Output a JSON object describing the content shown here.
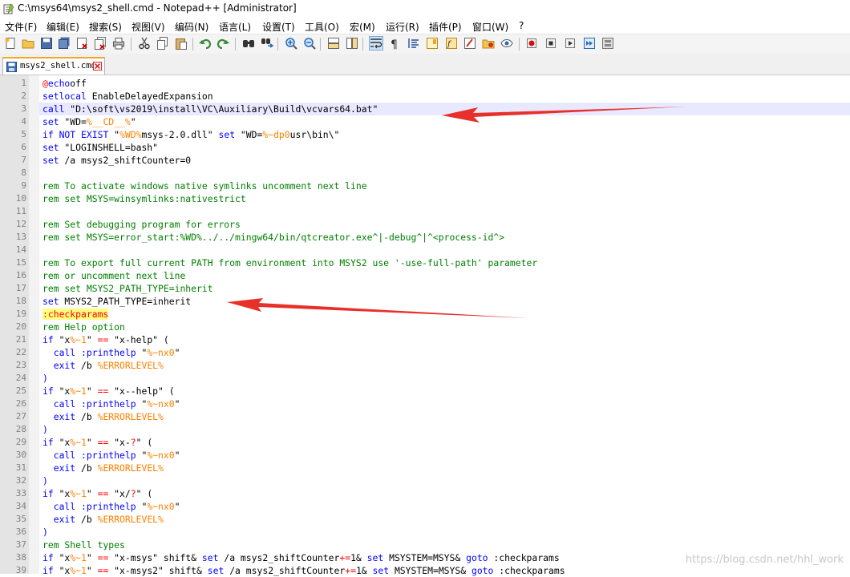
{
  "window": {
    "title": "C:\\msys64\\msys2_shell.cmd - Notepad++ [Administrator]"
  },
  "menu": [
    "文件(F)",
    "编辑(E)",
    "搜索(S)",
    "视图(V)",
    "编码(N)",
    "语言(L)",
    "设置(T)",
    "工具(O)",
    "宏(M)",
    "运行(R)",
    "插件(P)",
    "窗口(W)",
    "?"
  ],
  "toolbar_icons": [
    "new-file-icon",
    "open-file-icon",
    "save-icon",
    "save-all-icon",
    "close-icon",
    "close-all-icon",
    "print-icon",
    "cut-icon",
    "copy-icon",
    "paste-icon",
    "undo-icon",
    "redo-icon",
    "find-icon",
    "replace-icon",
    "zoom-in-icon",
    "zoom-out-icon",
    "sync-vertical-icon",
    "sync-horizontal-icon",
    "word-wrap-icon",
    "show-all-chars-icon",
    "indent-guide-icon",
    "doc-map-icon",
    "function-list-icon",
    "folder-as-workspace-icon",
    "monitor-icon",
    "record-macro-icon",
    "stop-record-icon",
    "play-macro-icon",
    "run-macro-multiple-icon",
    "save-macro-icon"
  ],
  "tab": {
    "label": "msys2_shell.cmd"
  },
  "colors": {
    "keyword": "#0000ff",
    "comment": "#008000",
    "variable": "#ff8000",
    "operator": "#ff0000",
    "label_bg": "#ffff80",
    "arrow": "#e8302a"
  },
  "code_lines": [
    [
      [
        "kw-op",
        "@"
      ],
      [
        "kw",
        "echo"
      ],
      [
        "",
        "off"
      ]
    ],
    [
      [
        "kw",
        "setlocal"
      ],
      [
        "",
        " EnableDelayedExpansion"
      ]
    ],
    [
      [
        "kw",
        "call"
      ],
      [
        "",
        " \"D:\\soft\\vs2019\\install\\VC\\Auxiliary\\Build\\vcvars64.bat\""
      ]
    ],
    [
      [
        "kw",
        "set"
      ],
      [
        "",
        " \"WD="
      ],
      [
        "var",
        "%__CD__%"
      ],
      [
        "",
        "\""
      ]
    ],
    [
      [
        "kw",
        "if"
      ],
      [
        "",
        " "
      ],
      [
        "kw",
        "NOT EXIST"
      ],
      [
        "",
        " \""
      ],
      [
        "var",
        "%WD%"
      ],
      [
        "",
        "msys-2.0.dll\" "
      ],
      [
        "kw",
        "set"
      ],
      [
        "",
        " \"WD="
      ],
      [
        "var",
        "%~dp0"
      ],
      [
        "",
        "usr\\bin\\\""
      ]
    ],
    [
      [
        "kw",
        "set"
      ],
      [
        "",
        " \"LOGINSHELL=bash\""
      ]
    ],
    [
      [
        "kw",
        "set"
      ],
      [
        "",
        " /a msys2_shiftCounter=0"
      ]
    ],
    [],
    [
      [
        "cm",
        "rem To activate windows native symlinks uncomment next line"
      ]
    ],
    [
      [
        "cm",
        "rem set MSYS=winsymlinks:nativestrict"
      ]
    ],
    [],
    [
      [
        "cm",
        "rem Set debugging program for errors"
      ]
    ],
    [
      [
        "cm",
        "rem set MSYS=error_start:%WD%../../mingw64/bin/qtcreator.exe^|-debug^|^<process-id^>"
      ]
    ],
    [],
    [
      [
        "cm",
        "rem To export full current PATH from environment into MSYS2 use '-use-full-path' parameter"
      ]
    ],
    [
      [
        "cm",
        "rem or uncomment next line"
      ]
    ],
    [
      [
        "cm",
        "rem set MSYS2_PATH_TYPE=inherit"
      ]
    ],
    [
      [
        "kw",
        "set"
      ],
      [
        "",
        " MSYS2_PATH_TYPE=inherit"
      ]
    ],
    [
      [
        "lbl",
        ":checkparams"
      ]
    ],
    [
      [
        "cm",
        "rem Help option"
      ]
    ],
    [
      [
        "kw",
        "if"
      ],
      [
        "",
        " \"x"
      ],
      [
        "var",
        "%~1"
      ],
      [
        "",
        "\" "
      ],
      [
        "kw-op",
        "=="
      ],
      [
        "",
        " \"x-help\" ("
      ]
    ],
    [
      [
        "",
        "  "
      ],
      [
        "kw",
        "call"
      ],
      [
        "",
        " "
      ],
      [
        "kw",
        ":printhelp"
      ],
      [
        "",
        " \""
      ],
      [
        "var",
        "%~nx0"
      ],
      [
        "",
        "\""
      ]
    ],
    [
      [
        "",
        "  "
      ],
      [
        "kw",
        "exit"
      ],
      [
        "",
        " /b "
      ],
      [
        "var",
        "%ERRORLEVEL%"
      ]
    ],
    [
      [
        "kw",
        ")"
      ]
    ],
    [
      [
        "kw",
        "if"
      ],
      [
        "",
        " \"x"
      ],
      [
        "var",
        "%~1"
      ],
      [
        "",
        "\" "
      ],
      [
        "kw-op",
        "=="
      ],
      [
        "",
        " \"x--help\" ("
      ]
    ],
    [
      [
        "",
        "  "
      ],
      [
        "kw",
        "call"
      ],
      [
        "",
        " "
      ],
      [
        "kw",
        ":printhelp"
      ],
      [
        "",
        " \""
      ],
      [
        "var",
        "%~nx0"
      ],
      [
        "",
        "\""
      ]
    ],
    [
      [
        "",
        "  "
      ],
      [
        "kw",
        "exit"
      ],
      [
        "",
        " /b "
      ],
      [
        "var",
        "%ERRORLEVEL%"
      ]
    ],
    [
      [
        "kw",
        ")"
      ]
    ],
    [
      [
        "kw",
        "if"
      ],
      [
        "",
        " \"x"
      ],
      [
        "var",
        "%~1"
      ],
      [
        "",
        "\" "
      ],
      [
        "kw-op",
        "=="
      ],
      [
        "",
        " \"x-"
      ],
      [
        "kw-op",
        "?"
      ],
      [
        "",
        "\" ("
      ]
    ],
    [
      [
        "",
        "  "
      ],
      [
        "kw",
        "call"
      ],
      [
        "",
        " "
      ],
      [
        "kw",
        ":printhelp"
      ],
      [
        "",
        " \""
      ],
      [
        "var",
        "%~nx0"
      ],
      [
        "",
        "\""
      ]
    ],
    [
      [
        "",
        "  "
      ],
      [
        "kw",
        "exit"
      ],
      [
        "",
        " /b "
      ],
      [
        "var",
        "%ERRORLEVEL%"
      ]
    ],
    [
      [
        "kw",
        ")"
      ]
    ],
    [
      [
        "kw",
        "if"
      ],
      [
        "",
        " \"x"
      ],
      [
        "var",
        "%~1"
      ],
      [
        "",
        "\" "
      ],
      [
        "kw-op",
        "=="
      ],
      [
        "",
        " \"x/"
      ],
      [
        "kw-op",
        "?"
      ],
      [
        "",
        "\" ("
      ]
    ],
    [
      [
        "",
        "  "
      ],
      [
        "kw",
        "call"
      ],
      [
        "",
        " "
      ],
      [
        "kw",
        ":printhelp"
      ],
      [
        "",
        " \""
      ],
      [
        "var",
        "%~nx0"
      ],
      [
        "",
        "\""
      ]
    ],
    [
      [
        "",
        "  "
      ],
      [
        "kw",
        "exit"
      ],
      [
        "",
        " /b "
      ],
      [
        "var",
        "%ERRORLEVEL%"
      ]
    ],
    [
      [
        "kw",
        ")"
      ]
    ],
    [
      [
        "cm",
        "rem Shell types"
      ]
    ],
    [
      [
        "kw",
        "if"
      ],
      [
        "",
        " \"x"
      ],
      [
        "var",
        "%~1"
      ],
      [
        "",
        "\" "
      ],
      [
        "kw-op",
        "=="
      ],
      [
        "",
        " \"x-msys\" shift& "
      ],
      [
        "kw",
        "set"
      ],
      [
        "",
        " /a msys2_shiftCounter"
      ],
      [
        "kw-op",
        "+="
      ],
      [
        "",
        "1& "
      ],
      [
        "kw",
        "set"
      ],
      [
        "",
        " MSYSTEM=MSYS& "
      ],
      [
        "kw",
        "goto"
      ],
      [
        "",
        " :checkparams"
      ]
    ],
    [
      [
        "kw",
        "if"
      ],
      [
        "",
        " \"x"
      ],
      [
        "var",
        "%~1"
      ],
      [
        "",
        "\" "
      ],
      [
        "kw-op",
        "=="
      ],
      [
        "",
        " \"x-msys2\" shift& "
      ],
      [
        "kw",
        "set"
      ],
      [
        "",
        " /a msys2_shiftCounter"
      ],
      [
        "kw-op",
        "+="
      ],
      [
        "",
        "1& "
      ],
      [
        "kw",
        "set"
      ],
      [
        "",
        " MSYSTEM=MSYS& "
      ],
      [
        "kw",
        "goto"
      ],
      [
        "",
        " :checkparams"
      ]
    ]
  ],
  "current_line": 3,
  "watermark": "https://blog.csdn.net/hhl_work"
}
